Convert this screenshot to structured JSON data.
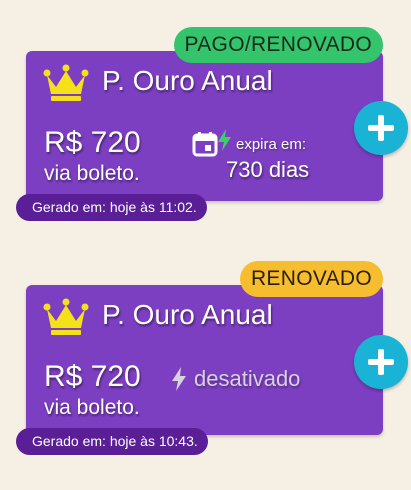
{
  "cards": [
    {
      "status_badge": "PAGO/RENOVADO",
      "title": "P. Ouro Anual",
      "price": "R$ 720",
      "payment_method": "via boleto.",
      "expire_label": "expira em:",
      "expire_days": "730 dias",
      "generated": "Gerado em: hoje às 11:02."
    },
    {
      "status_badge": "RENOVADO",
      "title": "P. Ouro Anual",
      "price": "R$ 720",
      "payment_method": "via boleto.",
      "disabled_label": "desativado",
      "generated": "Gerado em: hoje às 10:43."
    }
  ],
  "icons": {
    "crown": "crown-icon",
    "calendar": "calendar-icon",
    "bolt": "bolt-icon",
    "add": "plus-icon"
  },
  "colors": {
    "background": "#f6f0e4",
    "card": "#7d3fc2",
    "generated_pill": "#5a1e96",
    "badge_paid": "#33c46c",
    "badge_renewed": "#f6bd2f",
    "add_button": "#1ab3d6",
    "crown": "#f5e11a",
    "bolt_active": "#3ccf6a",
    "bolt_disabled": "#d8d2e0"
  }
}
